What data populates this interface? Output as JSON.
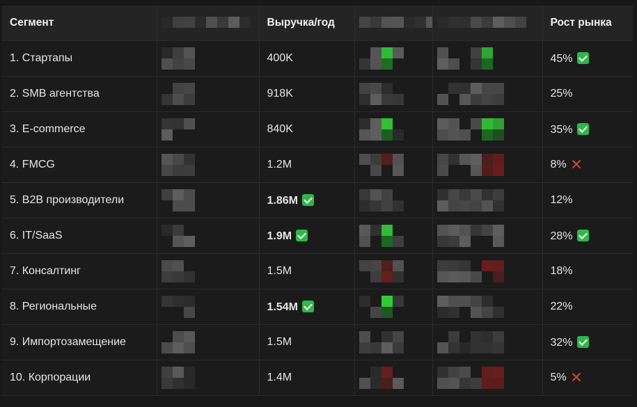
{
  "table": {
    "headers": [
      "Сегмент",
      "",
      "Выручка/год",
      "",
      "",
      "Рост рынка"
    ],
    "rows": [
      {
        "segment": "1. Стартапы",
        "revenue": "400K",
        "revenue_strong": false,
        "revenue_mark": "",
        "growth": "45%",
        "growth_mark": "check",
        "tint_a": "green",
        "tint_b": "green"
      },
      {
        "segment": "2. SMB агентства",
        "revenue": "918K",
        "revenue_strong": false,
        "revenue_mark": "",
        "growth": "25%",
        "growth_mark": "",
        "tint_a": "none",
        "tint_b": "none"
      },
      {
        "segment": "3. E-commerce",
        "revenue": "840K",
        "revenue_strong": false,
        "revenue_mark": "",
        "growth": "35%",
        "growth_mark": "check",
        "tint_a": "green",
        "tint_b": "green"
      },
      {
        "segment": "4. FMCG",
        "revenue": "1.2M",
        "revenue_strong": false,
        "revenue_mark": "",
        "growth": "8%",
        "growth_mark": "cross",
        "tint_a": "red",
        "tint_b": "red"
      },
      {
        "segment": "5. B2B производители",
        "revenue": "1.86M",
        "revenue_strong": true,
        "revenue_mark": "check",
        "growth": "12%",
        "growth_mark": "",
        "tint_a": "none",
        "tint_b": "none"
      },
      {
        "segment": "6. IT/SaaS",
        "revenue": "1.9M",
        "revenue_strong": true,
        "revenue_mark": "check",
        "growth": "28%",
        "growth_mark": "check",
        "tint_a": "green",
        "tint_b": "none"
      },
      {
        "segment": "7. Консалтинг",
        "revenue": "1.5M",
        "revenue_strong": false,
        "revenue_mark": "",
        "growth": "18%",
        "growth_mark": "",
        "tint_a": "red",
        "tint_b": "red"
      },
      {
        "segment": "8. Региональные",
        "revenue": "1.54M",
        "revenue_strong": true,
        "revenue_mark": "check",
        "growth": "22%",
        "growth_mark": "",
        "tint_a": "green",
        "tint_b": "none"
      },
      {
        "segment": "9. Импортозамещение",
        "revenue": "1.5M",
        "revenue_strong": false,
        "revenue_mark": "",
        "growth": "32%",
        "growth_mark": "check",
        "tint_a": "none",
        "tint_b": "none"
      },
      {
        "segment": "10. Корпорации",
        "revenue": "1.4M",
        "revenue_strong": false,
        "revenue_mark": "",
        "growth": "5%",
        "growth_mark": "cross",
        "tint_a": "red",
        "tint_b": "red"
      }
    ]
  },
  "colors": {
    "background": "#181818",
    "header_bg": "#242424",
    "cell_bg": "#1b1b1b",
    "check_green": "#2fb84a",
    "cross_red": "#e0452e"
  }
}
